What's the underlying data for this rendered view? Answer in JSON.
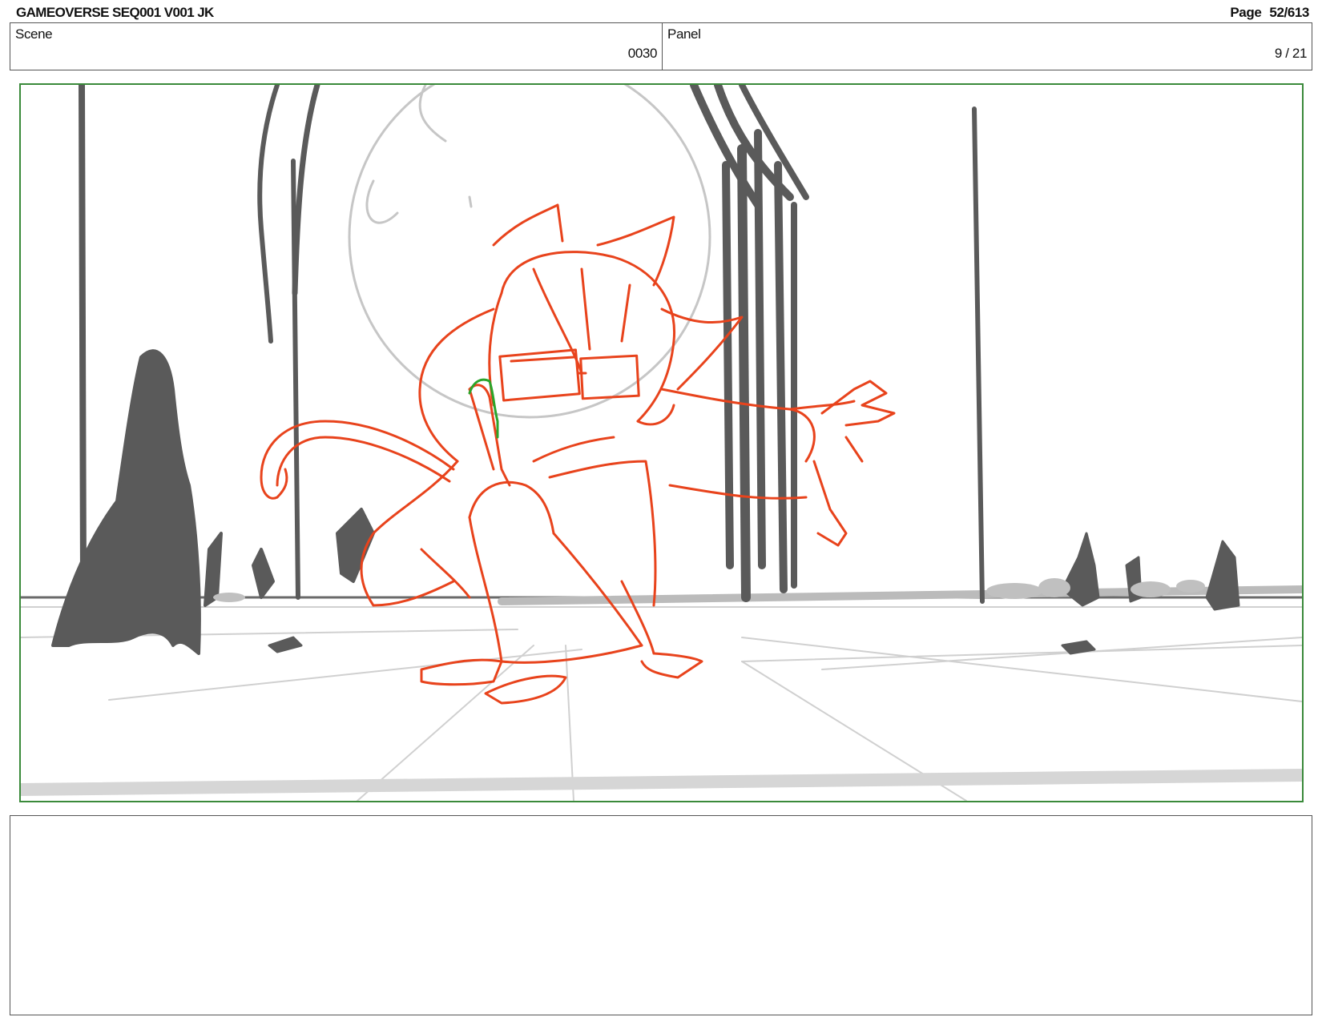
{
  "header": {
    "title": "GAMEOVERSE SEQ001 V001 JK",
    "page_label": "Page",
    "page_number": "52/613"
  },
  "info": {
    "scene_label": "Scene",
    "scene_value": "0030",
    "panel_label": "Panel",
    "panel_value": "9 / 21"
  },
  "colors": {
    "frame_border": "#3a8a3a",
    "sketch_red": "#e8431c",
    "sketch_green": "#2aa52a",
    "background_dark": "#5a5a5a",
    "background_light": "#c8c8c8"
  },
  "drawing": {
    "description_icon": "storyboard-sketch"
  }
}
